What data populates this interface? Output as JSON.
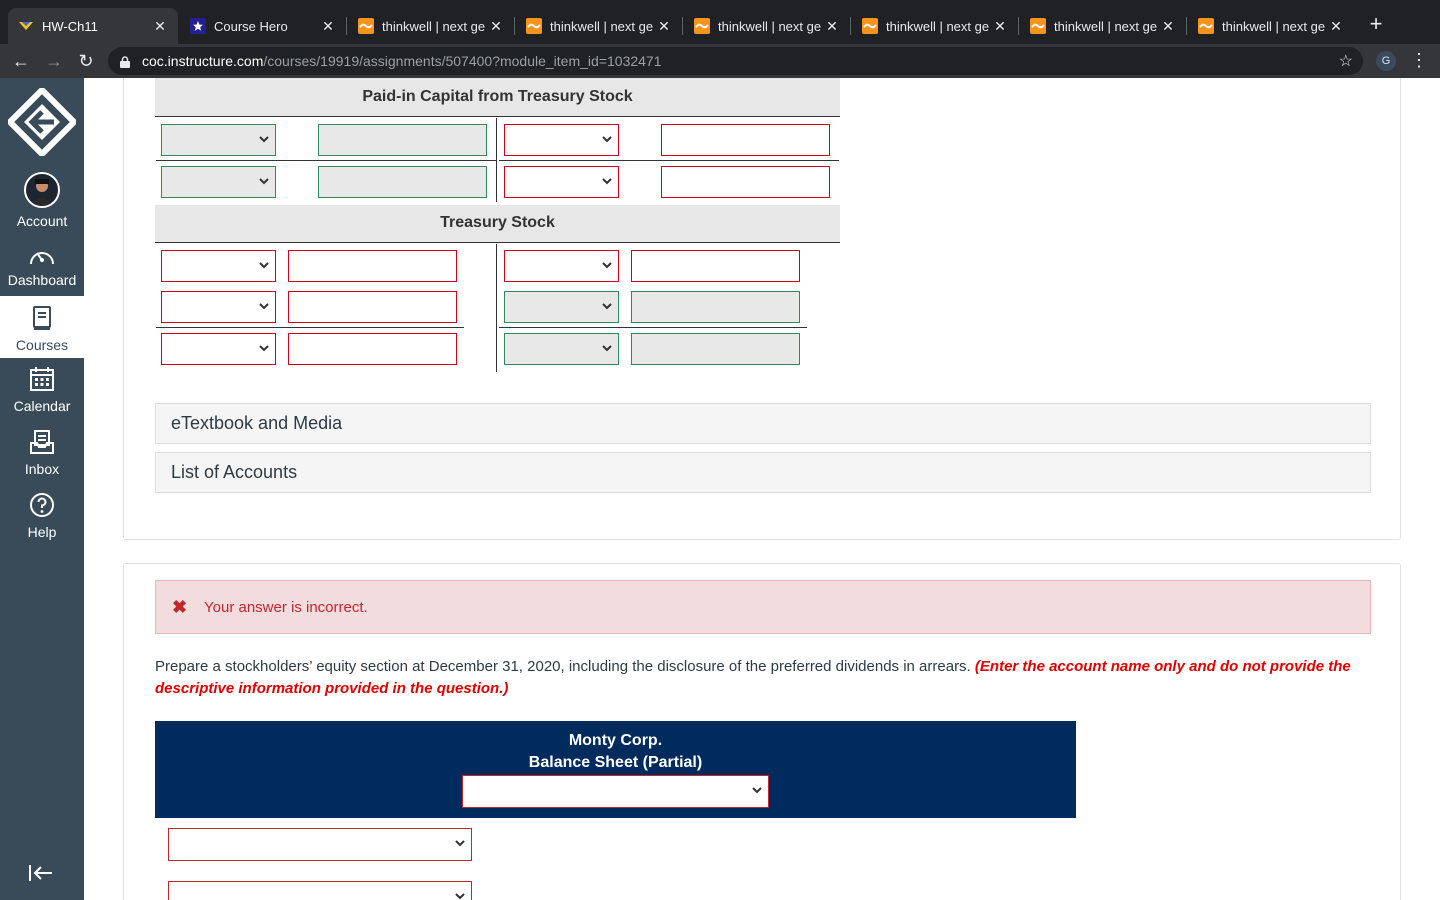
{
  "browser": {
    "tabs": [
      {
        "title": "HW-Ch11",
        "icon": "canvas-favicon-icon",
        "active": true
      },
      {
        "title": "Course Hero",
        "icon": "coursehero-favicon-icon",
        "active": false
      },
      {
        "title": "thinkwell | next ge",
        "icon": "thinkwell-favicon-icon",
        "active": false
      },
      {
        "title": "thinkwell | next ge",
        "icon": "thinkwell-favicon-icon",
        "active": false
      },
      {
        "title": "thinkwell | next ge",
        "icon": "thinkwell-favicon-icon",
        "active": false
      },
      {
        "title": "thinkwell | next ge",
        "icon": "thinkwell-favicon-icon",
        "active": false
      },
      {
        "title": "thinkwell | next ge",
        "icon": "thinkwell-favicon-icon",
        "active": false
      },
      {
        "title": "thinkwell | next ge",
        "icon": "thinkwell-favicon-icon",
        "active": false
      }
    ],
    "url_host": "coc.instructure.com",
    "url_path": "/courses/19919/assignments/507400?module_item_id=1032471",
    "profile_initial": "G"
  },
  "sidebar": {
    "items": [
      {
        "label": "Account",
        "icon": "account-avatar-icon"
      },
      {
        "label": "Dashboard",
        "icon": "dashboard-icon"
      },
      {
        "label": "Courses",
        "icon": "courses-icon"
      },
      {
        "label": "Calendar",
        "icon": "calendar-icon"
      },
      {
        "label": "Inbox",
        "icon": "inbox-icon"
      },
      {
        "label": "Help",
        "icon": "help-icon"
      }
    ],
    "active": "Courses"
  },
  "t_accounts": {
    "paid_in_title": "Paid-in Capital from Treasury Stock",
    "treasury_title": "Treasury Stock"
  },
  "accordions": {
    "etextbook": "eTextbook and Media",
    "accounts": "List of Accounts"
  },
  "feedback": {
    "message": "Your answer is incorrect."
  },
  "question": {
    "text": "Prepare a stockholders’ equity section at December 31, 2020, including the disclosure of the preferred dividends in arrears. ",
    "instruction": "(Enter the account name only and do not provide the descriptive information provided in the question.)"
  },
  "balance_sheet": {
    "company": "Monty Corp.",
    "title": "Balance Sheet (Partial)"
  },
  "colors": {
    "chrome_dark": "#202124",
    "sidebar": "#394b58",
    "header_navy": "#002b5c",
    "error_red": "#d0021b",
    "correct_green": "#2e8b57"
  }
}
